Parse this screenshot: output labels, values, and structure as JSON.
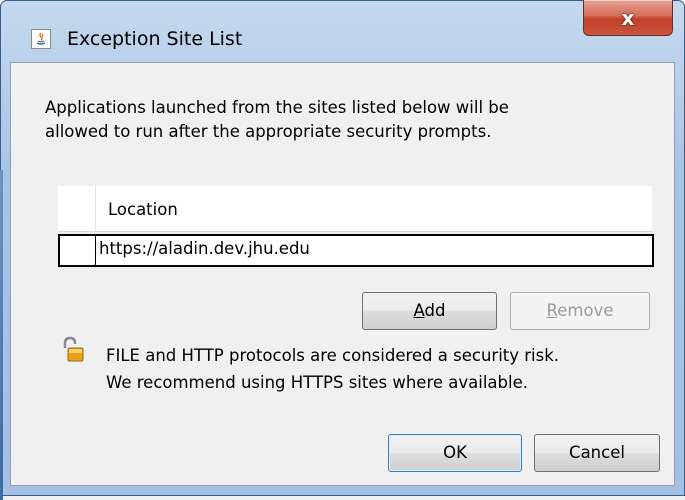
{
  "window": {
    "title": "Exception Site List",
    "close_label": "x"
  },
  "intro": {
    "line1": "Applications launched from the sites listed below will be",
    "line2": "allowed to run after the appropriate security prompts."
  },
  "table": {
    "column_header": "Location",
    "rows": [
      {
        "location": "https://aladin.dev.jhu.edu"
      }
    ]
  },
  "buttons": {
    "add_mnemonic": "A",
    "add_rest": "dd",
    "remove_mnemonic": "R",
    "remove_rest": "emove",
    "ok": "OK",
    "cancel": "Cancel"
  },
  "warning": {
    "line1": "FILE and HTTP protocols are considered a security risk.",
    "line2": "We recommend using HTTPS sites where available."
  },
  "icons": {
    "app": "java-icon",
    "warning": "unlocked-padlock-icon"
  },
  "colors": {
    "frame": "#a9c3e4",
    "close": "#c2412a",
    "client": "#f0f0f0"
  }
}
